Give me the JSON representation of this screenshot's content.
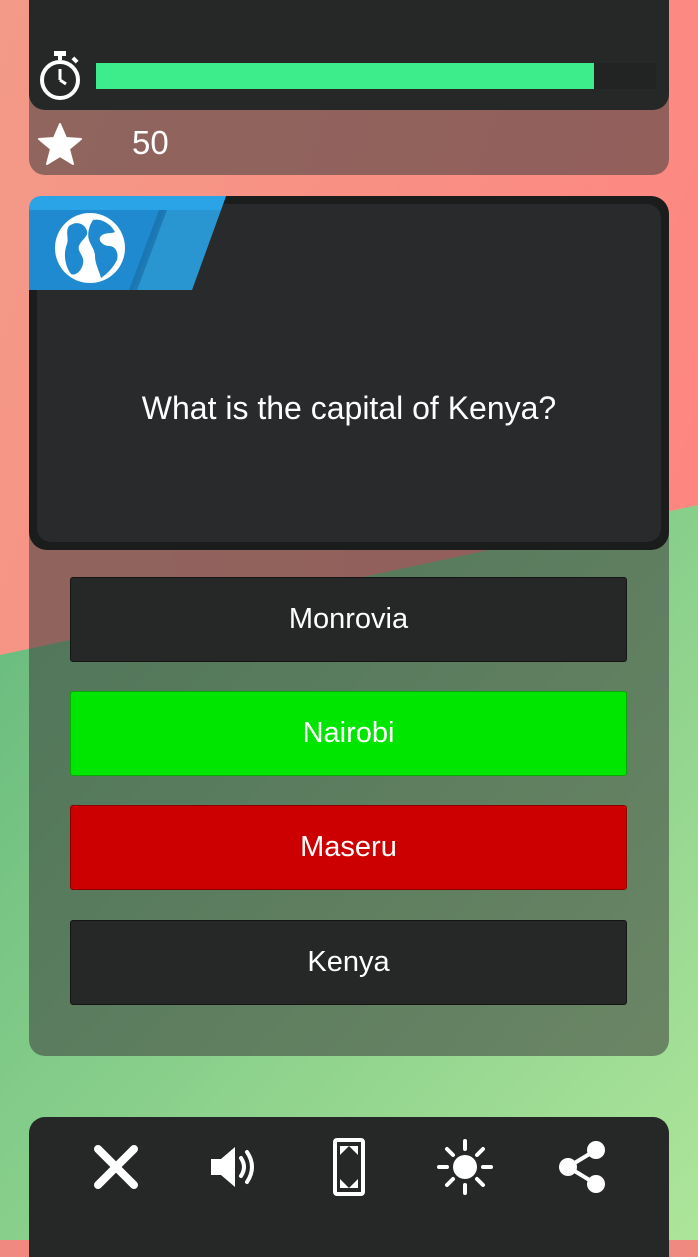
{
  "colors": {
    "bg_top": "#f5897f",
    "bg_bottom": "#78c88a",
    "panel_dark": "#262828",
    "progress_fill": "#3ded8c",
    "badge_blue": "#2aa0dc",
    "correct": "#00e600",
    "wrong": "#cc0000",
    "neutral": "#262828"
  },
  "timer": {
    "icon": "stopwatch-icon",
    "progress": 0.89
  },
  "score": {
    "icon": "star-icon",
    "value": "50"
  },
  "question": {
    "category_icon": "globe-icon",
    "text": "What is the capital of Kenya?"
  },
  "answers": [
    {
      "label": "Monrovia",
      "state": "neutral"
    },
    {
      "label": "Nairobi",
      "state": "correct"
    },
    {
      "label": "Maseru",
      "state": "wrong"
    },
    {
      "label": "Kenya",
      "state": "neutral"
    }
  ],
  "toolbar": [
    "close-icon",
    "sound-icon",
    "fullscreen-icon",
    "brightness-icon",
    "share-icon"
  ]
}
